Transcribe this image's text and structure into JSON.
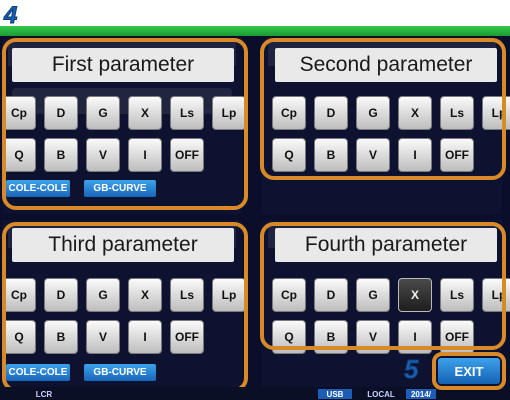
{
  "step_labels": {
    "step_a": "4",
    "step_b": "5"
  },
  "panels": {
    "first": {
      "title": "First parameter",
      "row1": [
        "Cp",
        "D",
        "G",
        "X",
        "Ls",
        "Lp"
      ],
      "row2": [
        "Q",
        "B",
        "V",
        "I",
        "OFF"
      ],
      "extras": [
        "COLE-COLE",
        "GB-CURVE"
      ]
    },
    "second": {
      "title": "Second parameter",
      "row1": [
        "Cp",
        "D",
        "G",
        "X",
        "Ls",
        "Lp"
      ],
      "row2": [
        "Q",
        "B",
        "V",
        "I",
        "OFF"
      ]
    },
    "third": {
      "title": "Third parameter",
      "row1": [
        "Cp",
        "D",
        "G",
        "X",
        "Ls",
        "Lp"
      ],
      "row2": [
        "Q",
        "B",
        "V",
        "I",
        "OFF"
      ],
      "extras": [
        "COLE-COLE",
        "GB-CURVE"
      ]
    },
    "fourth": {
      "title": "Fourth parameter",
      "row1": [
        "Cp",
        "D",
        "G",
        "X",
        "Ls",
        "Lp"
      ],
      "row2": [
        "Q",
        "B",
        "V",
        "I",
        "OFF"
      ],
      "selected": "X"
    }
  },
  "exit_label": "EXIT",
  "status_bar": [
    "LCR",
    "USB",
    "LOCAL",
    "2014/"
  ],
  "colors": {
    "highlight_outline": "#d88a28",
    "screen_bg": "#0a0e2a",
    "button_blue": "#1e77cf"
  }
}
